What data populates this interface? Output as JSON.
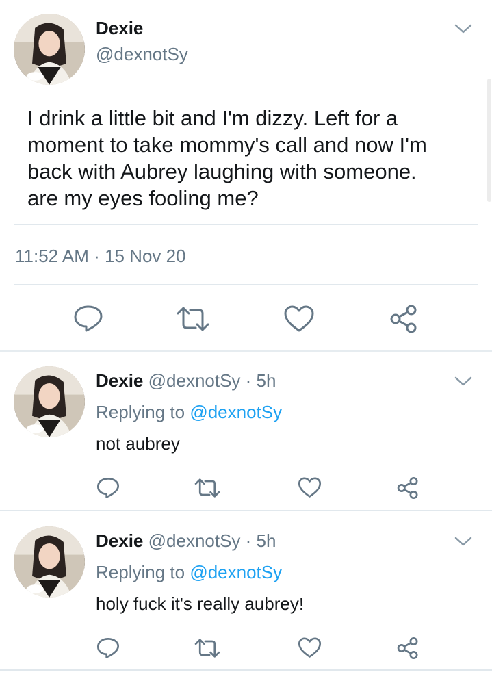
{
  "main_tweet": {
    "author_name": "Dexie",
    "handle": "@dexnotSy",
    "text": "I drink a little bit and I'm dizzy.  Left for a moment to take mommy's call and now I'm back with Aubrey laughing with someone. are my eyes fooling me?",
    "text_lines": [
      "I drink a little bit and I'm dizzy.  Left for a",
      "moment to take mommy's call and now I'm",
      "back with Aubrey laughing with someone.",
      "are my eyes fooling me?"
    ],
    "timestamp": "11:52 AM · 15 Nov 20"
  },
  "replies": [
    {
      "author_name": "Dexie",
      "handle": "@dexnotSy",
      "age": "· 5h",
      "replying_prefix": "Replying to",
      "replying_to": "@dexnotSy",
      "text": "not aubrey"
    },
    {
      "author_name": "Dexie",
      "handle": "@dexnotSy",
      "age": "· 5h",
      "replying_prefix": "Replying to",
      "replying_to": "@dexnotSy",
      "text": "holy fuck it's really aubrey!"
    }
  ],
  "icons": {
    "reply": "reply-icon",
    "retweet": "retweet-icon",
    "like": "heart-icon",
    "share": "share-icon",
    "more": "chevron-down-icon"
  },
  "colors": {
    "accent_link": "#1da1f2",
    "secondary_text": "#657786",
    "divider": "#e1e8ed"
  }
}
